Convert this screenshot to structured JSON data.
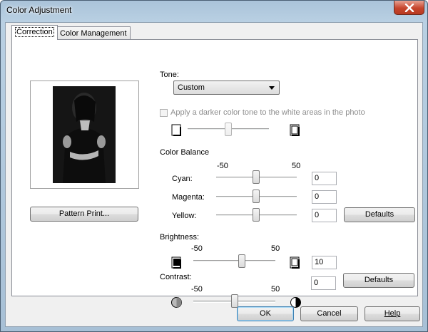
{
  "window": {
    "title": "Color Adjustment"
  },
  "tabs": [
    {
      "label": "Correction"
    },
    {
      "label": "Color Management"
    }
  ],
  "correction": {
    "pattern_print_label": "Pattern Print...",
    "tone": {
      "label": "Tone:",
      "selected": "Custom",
      "darker_tone_checkbox": {
        "label": "Apply a darker color tone to the white areas in the photo",
        "checked": false,
        "enabled": false
      },
      "slider_position": 0.5
    },
    "color_balance": {
      "label": "Color Balance",
      "min_label": "-50",
      "max_label": "50",
      "cyan": {
        "label": "Cyan:",
        "value": "0"
      },
      "magenta": {
        "label": "Magenta:",
        "value": "0"
      },
      "yellow": {
        "label": "Yellow:",
        "value": "0"
      },
      "defaults_label": "Defaults"
    },
    "brightness": {
      "label": "Brightness:",
      "min_label": "-50",
      "max_label": "50",
      "value": "10"
    },
    "contrast": {
      "label": "Contrast:",
      "min_label": "-50",
      "max_label": "50",
      "value": "0",
      "defaults_label": "Defaults"
    }
  },
  "footer": {
    "ok_label": "OK",
    "cancel_label": "Cancel",
    "help_label": "Help"
  },
  "colors": {
    "title_bar": "#b9d0e3",
    "close_button": "#c6452c",
    "dialog_bg": "#f0f0f0"
  }
}
